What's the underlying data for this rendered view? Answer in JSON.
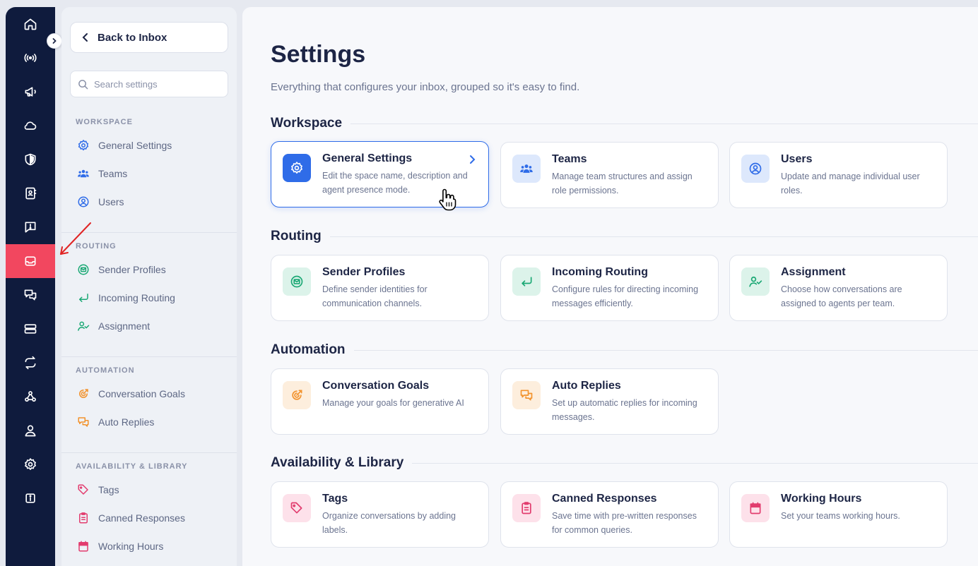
{
  "rail": {
    "items": [
      {
        "icon": "home-icon"
      },
      {
        "icon": "broadcast-icon"
      },
      {
        "icon": "megaphone-icon"
      },
      {
        "icon": "cloud-icon"
      },
      {
        "icon": "shield-icon"
      },
      {
        "icon": "contact-book-icon"
      },
      {
        "icon": "message-alert-icon"
      },
      {
        "icon": "inbox-icon",
        "active": true
      },
      {
        "icon": "chat-bubbles-icon"
      },
      {
        "icon": "server-icon"
      },
      {
        "icon": "swap-arrows-icon"
      },
      {
        "icon": "webhook-icon"
      },
      {
        "icon": "user-icon"
      },
      {
        "icon": "gear-icon"
      },
      {
        "icon": "info-icon"
      }
    ],
    "active_color": "#f2475f",
    "background": "#0f1b3d"
  },
  "sidebar": {
    "back_label": "Back to Inbox",
    "search_placeholder": "Search settings",
    "sections": [
      {
        "title": "WORKSPACE",
        "items": [
          {
            "label": "General Settings",
            "icon": "gear-icon"
          },
          {
            "label": "Teams",
            "icon": "team-icon"
          },
          {
            "label": "Users",
            "icon": "user-circle-icon"
          }
        ]
      },
      {
        "title": "ROUTING",
        "items": [
          {
            "label": "Sender Profiles",
            "icon": "mail-circle-icon"
          },
          {
            "label": "Incoming Routing",
            "icon": "return-arrow-icon"
          },
          {
            "label": "Assignment",
            "icon": "user-check-icon"
          }
        ]
      },
      {
        "title": "AUTOMATION",
        "items": [
          {
            "label": "Conversation Goals",
            "icon": "target-icon"
          },
          {
            "label": "Auto Replies",
            "icon": "chat-bubbles-icon"
          }
        ]
      },
      {
        "title": "AVAILABILITY & LIBRARY",
        "items": [
          {
            "label": "Tags",
            "icon": "tag-icon"
          },
          {
            "label": "Canned Responses",
            "icon": "clipboard-icon"
          },
          {
            "label": "Working Hours",
            "icon": "calendar-icon"
          }
        ]
      }
    ]
  },
  "main": {
    "title": "Settings",
    "subtitle": "Everything that configures your inbox, grouped so it's easy to find.",
    "sections": [
      {
        "heading": "Workspace",
        "cards": [
          {
            "title": "General Settings",
            "desc": "Edit the space name, description and agent presence mode.",
            "icon": "gear-icon",
            "selected": true
          },
          {
            "title": "Teams",
            "desc": "Manage team structures and assign role permissions.",
            "icon": "team-icon"
          },
          {
            "title": "Users",
            "desc": "Update and manage individual user roles.",
            "icon": "user-circle-icon"
          }
        ]
      },
      {
        "heading": "Routing",
        "cards": [
          {
            "title": "Sender Profiles",
            "desc": "Define sender identities for communication channels.",
            "icon": "mail-circle-icon"
          },
          {
            "title": "Incoming Routing",
            "desc": "Configure rules for directing incoming messages efficiently.",
            "icon": "return-arrow-icon"
          },
          {
            "title": "Assignment",
            "desc": "Choose how conversations are assigned to agents per team.",
            "icon": "user-check-icon"
          }
        ]
      },
      {
        "heading": "Automation",
        "cards": [
          {
            "title": "Conversation Goals",
            "desc": "Manage your goals for generative AI",
            "icon": "target-icon"
          },
          {
            "title": "Auto Replies",
            "desc": "Set up automatic replies for incoming messages.",
            "icon": "chat-bubbles-icon"
          }
        ]
      },
      {
        "heading": "Availability & Library",
        "cards": [
          {
            "title": "Tags",
            "desc": "Organize conversations by adding labels.",
            "icon": "tag-icon"
          },
          {
            "title": "Canned Responses",
            "desc": "Save time with pre-written responses for common queries.",
            "icon": "clipboard-icon"
          },
          {
            "title": "Working Hours",
            "desc": "Set your teams working hours.",
            "icon": "calendar-icon"
          }
        ]
      }
    ]
  },
  "colors": {
    "workspace_accent": "#2f6ce8",
    "routing_accent": "#1aa874",
    "automation_accent": "#f2922c",
    "library_accent": "#e23c6e"
  }
}
